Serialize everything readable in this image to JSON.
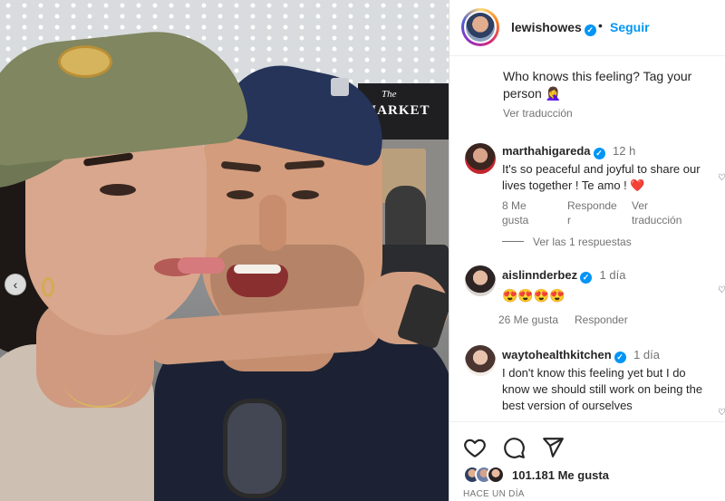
{
  "photo": {
    "store_sign_the": "The",
    "store_sign_market": "MARKET",
    "prev_icon": "chevron-left-icon"
  },
  "post": {
    "username": "lewishowes",
    "verified_icon": "verified-badge-icon",
    "separator": "•",
    "follow_label": "Seguir",
    "caption": "Who knows this feeling? Tag your person 🤦‍♀️",
    "see_translation": "Ver traducción"
  },
  "comments": [
    {
      "username": "marthahigareda",
      "time": "12 h",
      "text": "It's so peaceful and joyful to share our lives together ! Te amo ! ❤️",
      "likes": "8 Me gusta",
      "reply": "Responder",
      "translate": "Ver traducción",
      "view_replies": "Ver las 1 respuestas"
    },
    {
      "username": "aislinnderbez",
      "time": "1 día",
      "text": "😍😍😍😍",
      "likes": "26 Me gusta",
      "reply": "Responder"
    },
    {
      "username": "waytohealthkitchen",
      "time": "1 día",
      "text": "I don't know this feeling yet but I do know we should still work on being the best version of ourselves"
    }
  ],
  "actions": {
    "like_icon": "heart-icon",
    "comment_icon": "comment-icon",
    "share_icon": "send-icon",
    "likes_count": "101.181 Me gusta",
    "time_ago": "HACE UN DÍA"
  },
  "colors": {
    "accent": "#0095f6",
    "heart": "#ed4956",
    "text": "#262626",
    "secondary": "#737373"
  }
}
